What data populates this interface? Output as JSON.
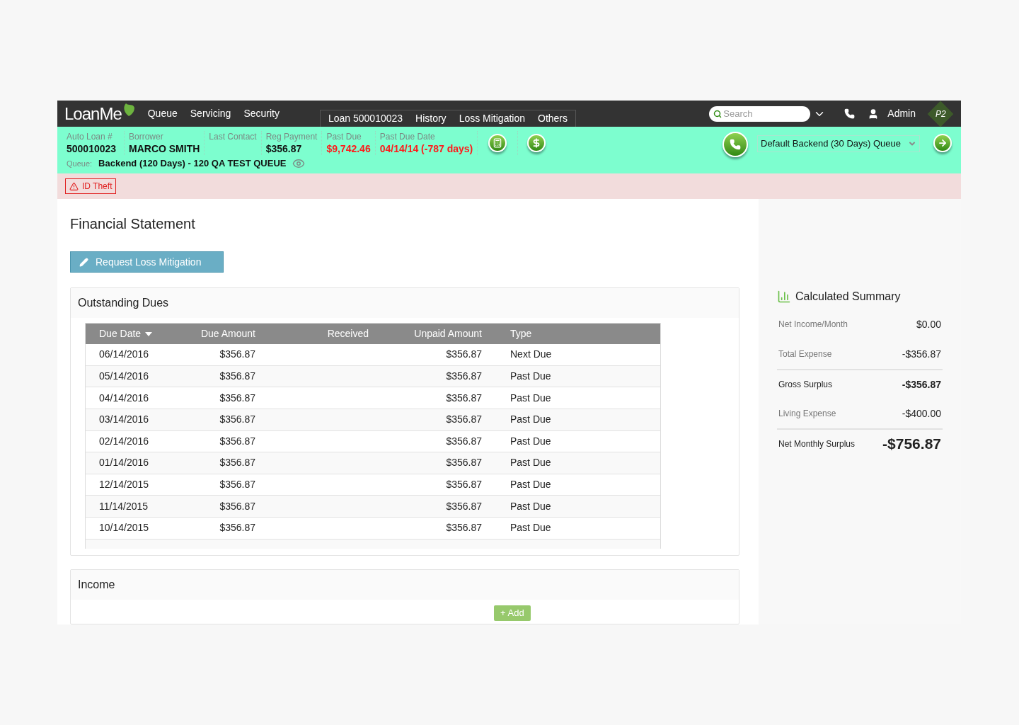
{
  "top_nav": {
    "logo": "LoanMe",
    "menu": [
      {
        "label": "Queue"
      },
      {
        "label": "Servicing"
      },
      {
        "label": "Security"
      }
    ],
    "tabs": [
      {
        "label": "Loan 500010023"
      },
      {
        "label": "History"
      },
      {
        "label": "Loss Mitigation"
      },
      {
        "label": "Others"
      }
    ],
    "search": {
      "placeholder": "Search"
    },
    "user": "Admin",
    "badge": "P2"
  },
  "loan_header": {
    "fields": [
      {
        "label": "Auto Loan #",
        "value": "500010023",
        "alert": false
      },
      {
        "label": "Borrower",
        "value": "MARCO SMITH",
        "alert": false
      },
      {
        "label": "Last Contact"
      },
      {
        "label": "Reg Payment",
        "value": "$356.87",
        "alert": false
      },
      {
        "label": "Past Due",
        "value": "$9,742.46",
        "alert": true
      },
      {
        "label": "Past Due Date",
        "value": "04/14/14 (-787 days)",
        "alert": true
      }
    ],
    "queue_label": "Queue:",
    "queue": "Backend (120 Days) - 120 QA TEST QUEUE",
    "queue_select": "Default Backend (30 Days) Queue"
  },
  "alerts": [
    {
      "label": "ID Theft"
    }
  ],
  "page_title": "Financial Statement",
  "action_button": "Request Loss Mitigation",
  "outstanding_dues": {
    "title": "Outstanding Dues",
    "columns": [
      "Due Date",
      "Due Amount",
      "Received",
      "Unpaid Amount",
      "Type"
    ],
    "rows": [
      [
        "06/14/2016",
        "$356.87",
        "",
        "$356.87",
        "Next Due"
      ],
      [
        "05/14/2016",
        "$356.87",
        "",
        "$356.87",
        "Past Due"
      ],
      [
        "04/14/2016",
        "$356.87",
        "",
        "$356.87",
        "Past Due"
      ],
      [
        "03/14/2016",
        "$356.87",
        "",
        "$356.87",
        "Past Due"
      ],
      [
        "02/14/2016",
        "$356.87",
        "",
        "$356.87",
        "Past Due"
      ],
      [
        "01/14/2016",
        "$356.87",
        "",
        "$356.87",
        "Past Due"
      ],
      [
        "12/14/2015",
        "$356.87",
        "",
        "$356.87",
        "Past Due"
      ],
      [
        "11/14/2015",
        "$356.87",
        "",
        "$356.87",
        "Past Due"
      ],
      [
        "10/14/2015",
        "$356.87",
        "",
        "$356.87",
        "Past Due"
      ]
    ]
  },
  "income": {
    "title": "Income",
    "add_button": "+ Add"
  },
  "summary": {
    "title": "Calculated Summary",
    "rows": [
      {
        "kind": "plain",
        "label": "Net Income/Month",
        "value": "$0.00"
      },
      {
        "kind": "plain",
        "label": "Total Expense",
        "value": "-$356.87"
      },
      {
        "kind": "bold",
        "label": "Gross Surplus",
        "value": "-$356.87"
      },
      {
        "kind": "plain",
        "label": "Living Expense",
        "value": "-$400.00"
      },
      {
        "kind": "grand",
        "label": "Net Monthly Surplus",
        "value": "-$756.87"
      }
    ]
  }
}
